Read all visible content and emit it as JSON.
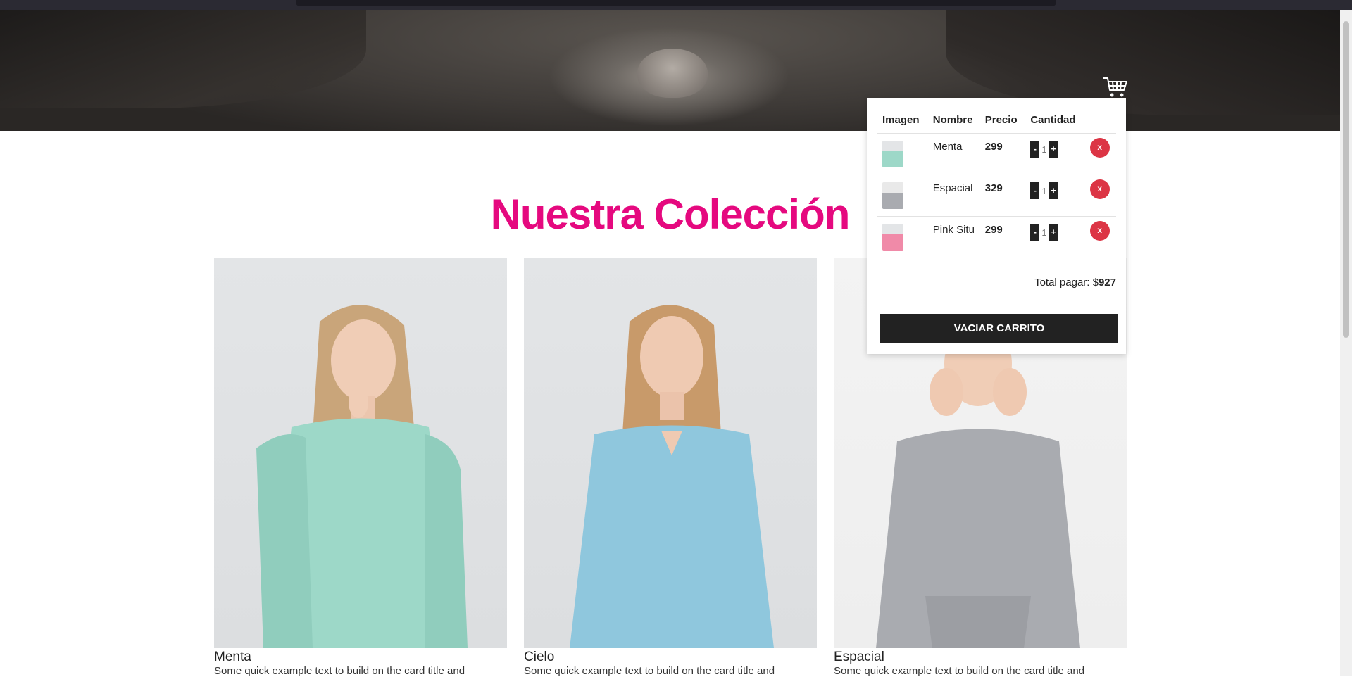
{
  "page": {
    "title": "Nuestra Colección",
    "accent_color": "#e5097f",
    "hero_image": "woman-in-hat-banner",
    "cart_icon": "shopping-cart-icon"
  },
  "cards": [
    {
      "name": "Menta",
      "description": "Some quick example text to build on the card title and",
      "sweater_color": "#9dd8c8"
    },
    {
      "name": "Cielo",
      "description": "Some quick example text to build on the card title and",
      "sweater_color": "#8fc7dd"
    },
    {
      "name": "Espacial",
      "description": "Some quick example text to build on the card title and",
      "sweater_color": "#a9abb0"
    }
  ],
  "cart": {
    "headers": {
      "image": "Imagen",
      "name": "Nombre",
      "price": "Precio",
      "quantity": "Cantidad"
    },
    "items": [
      {
        "name": "Menta",
        "price": "299",
        "quantity": "1",
        "thumb_color": "#9dd8c8"
      },
      {
        "name": "Espacial",
        "price": "329",
        "quantity": "1",
        "thumb_color": "#a9abb0"
      },
      {
        "name": "Pink Situ",
        "price": "299",
        "quantity": "1",
        "thumb_color": "#f08aa8"
      }
    ],
    "minus_label": "-",
    "plus_label": "+",
    "remove_label": "x",
    "total_label": "Total pagar: $",
    "total_value": "927",
    "empty_button_label": "VACIAR CARRITO"
  }
}
